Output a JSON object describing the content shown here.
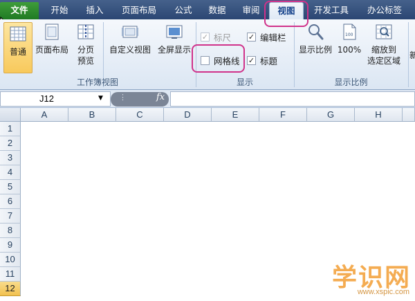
{
  "tabs": {
    "file": "文件",
    "home": "开始",
    "insert": "插入",
    "page_layout": "页面布局",
    "formulas": "公式",
    "data": "数据",
    "review": "审阅",
    "view": "视图",
    "developer": "开发工具",
    "office_tab": "办公标签"
  },
  "ribbon": {
    "workbook_views": {
      "normal": "普通",
      "page_layout": "页面布局",
      "page_break_1": "分页",
      "page_break_2": "预览",
      "custom_views": "自定义视图",
      "full_screen": "全屏显示",
      "group_label": "工作簿视图"
    },
    "show": {
      "ruler": "标尺",
      "ruler_checked": true,
      "formula_bar": "编辑栏",
      "formula_bar_checked": true,
      "gridlines": "网格线",
      "gridlines_checked": false,
      "headings": "标题",
      "headings_checked": true,
      "group_label": "显示"
    },
    "zoom": {
      "zoom": "显示比例",
      "hundred": "100%",
      "zoom_sel_1": "缩放到",
      "zoom_sel_2": "选定区域",
      "group_label": "显示比例"
    },
    "more": "新"
  },
  "formula_bar": {
    "name_box": "J12",
    "fx": "fx",
    "value": ""
  },
  "grid": {
    "columns": [
      "A",
      "B",
      "C",
      "D",
      "E",
      "F",
      "G",
      "H"
    ],
    "rows": [
      "1",
      "2",
      "3",
      "4",
      "5",
      "6",
      "7",
      "8",
      "9",
      "10",
      "11",
      "12"
    ],
    "active_row": "12"
  },
  "watermark": {
    "main": "学识网",
    "sub": "www.xspic.com"
  },
  "colors": {
    "tab_bar": "#2f4b78",
    "file_tab": "#2a8a2c",
    "highlight": "#d0318a",
    "active_header": "#f5cd5f",
    "watermark": "#f3a13b"
  }
}
